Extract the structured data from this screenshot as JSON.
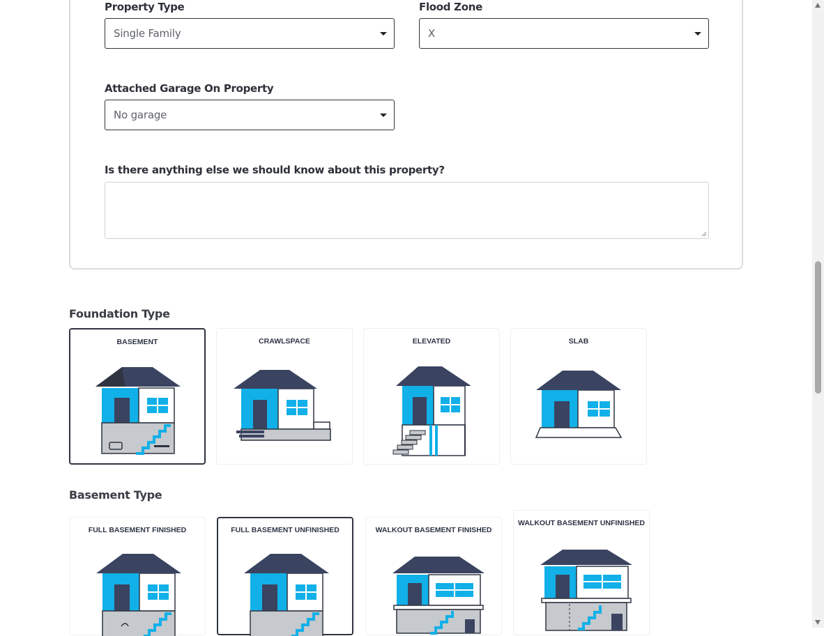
{
  "form": {
    "property_type": {
      "label": "Property Type",
      "value": "Single Family"
    },
    "flood_zone": {
      "label": "Flood Zone",
      "value": "X"
    },
    "garage": {
      "label": "Attached Garage On Property",
      "value": "No garage"
    },
    "notes": {
      "label": "Is there anything else we should know about this property?",
      "value": ""
    }
  },
  "foundation": {
    "heading": "Foundation Type",
    "selected": "BASEMENT",
    "options": [
      {
        "label": "BASEMENT",
        "icon": "house-basement-icon"
      },
      {
        "label": "CRAWLSPACE",
        "icon": "house-crawlspace-icon"
      },
      {
        "label": "ELEVATED",
        "icon": "house-elevated-icon"
      },
      {
        "label": "SLAB",
        "icon": "house-slab-icon"
      }
    ]
  },
  "basement": {
    "heading": "Basement Type",
    "selected": "FULL BASEMENT UNFINISHED",
    "options": [
      {
        "label": "FULL BASEMENT FINISHED",
        "icon": "house-basement-finished-icon"
      },
      {
        "label": "FULL BASEMENT UNFINISHED",
        "icon": "house-basement-unfinished-icon"
      },
      {
        "label": "WALKOUT BASEMENT FINISHED",
        "icon": "house-walkout-finished-icon"
      },
      {
        "label": "WALKOUT BASEMENT UNFINISHED",
        "icon": "house-walkout-unfinished-icon"
      }
    ]
  },
  "colors": {
    "wall_blue": "#12b0e8",
    "roof_navy": "#3a4360",
    "basement_grey": "#c6c9cd",
    "border_dark": "#2f3440"
  }
}
